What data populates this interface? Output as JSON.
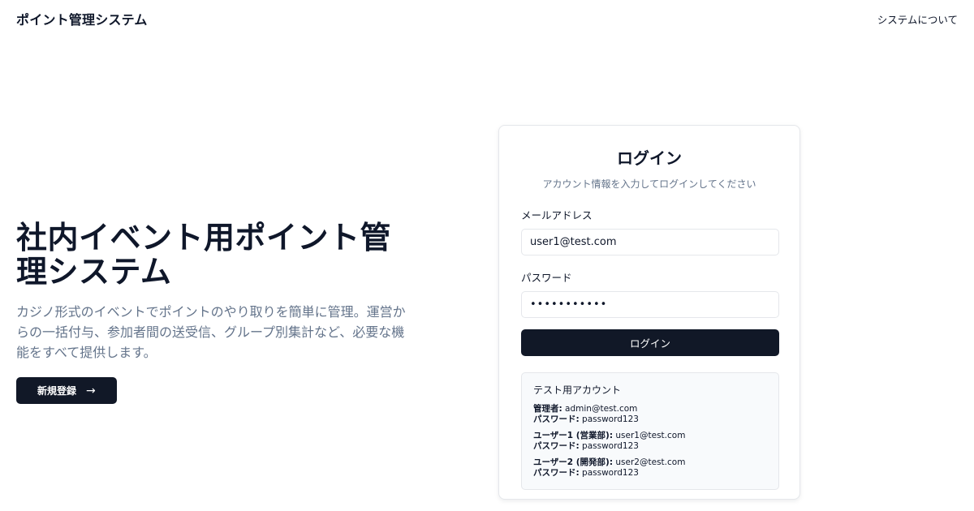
{
  "header": {
    "brand": "ポイント管理システム",
    "about_link": "システムについて"
  },
  "hero": {
    "title": "社内イベント用ポイント管理システム",
    "description": "カジノ形式のイベントでポイントのやり取りを簡単に管理。運営からの一括付与、参加者間の送受信、グループ別集計など、必要な機能をすべて提供します。",
    "cta_label": "新規登録",
    "cta_icon": "arrow-right-icon"
  },
  "login": {
    "title": "ログイン",
    "subtitle": "アカウント情報を入力してログインしてください",
    "email_label": "メールアドレス",
    "email_value": "user1@test.com",
    "password_label": "パスワード",
    "password_value": "•••••••••••",
    "submit_label": "ログイン"
  },
  "test_accounts": {
    "title": "テスト用アカウント",
    "accounts": [
      {
        "role": "管理者:",
        "email": "admin@test.com",
        "password_label": "パスワード:",
        "password": "password123"
      },
      {
        "role": "ユーザー1 (営業部):",
        "email": "user1@test.com",
        "password_label": "パスワード:",
        "password": "password123"
      },
      {
        "role": "ユーザー2 (開発部):",
        "email": "user2@test.com",
        "password_label": "パスワード:",
        "password": "password123"
      }
    ]
  },
  "colors": {
    "primary": "#111827",
    "text": "#0f172a",
    "muted": "#64748b",
    "border": "#e5e7eb"
  }
}
